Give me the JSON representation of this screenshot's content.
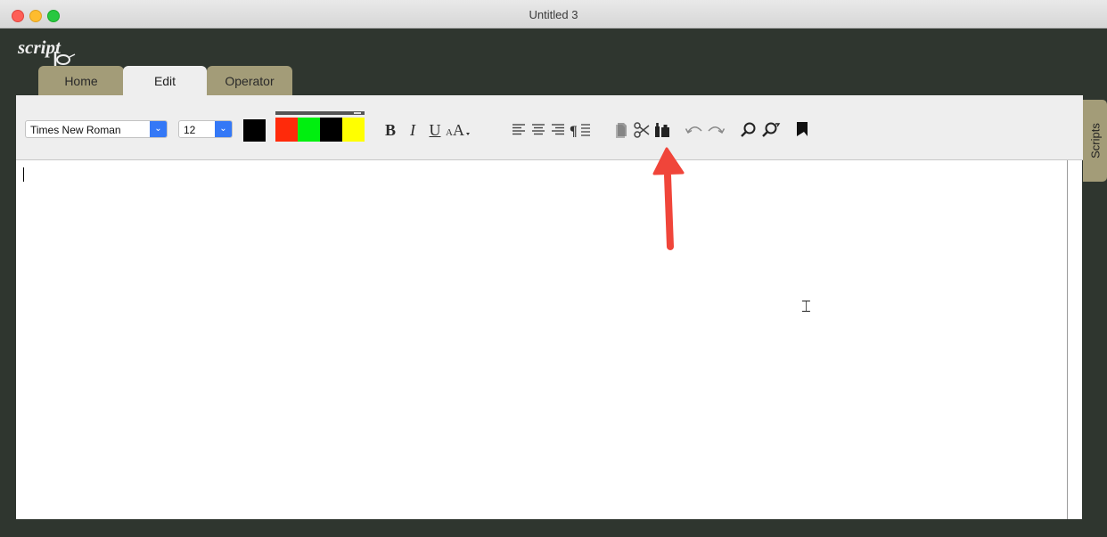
{
  "window": {
    "title": "Untitled 3"
  },
  "app": {
    "logo_text": "script"
  },
  "tabs": [
    {
      "label": "Home"
    },
    {
      "label": "Edit",
      "active": true
    },
    {
      "label": "Operator"
    }
  ],
  "toolbar": {
    "font": {
      "value": "Times New Roman"
    },
    "size": {
      "value": "12"
    },
    "text_color": "#000000",
    "highlight_colors": [
      "#ff2a0a",
      "#00ef0f",
      "#000000",
      "#ffff00"
    ],
    "format_labels": {
      "bold": "B",
      "italic": "I",
      "underline": "U",
      "text_size": "AA"
    },
    "icons": {
      "bold": "bold-icon",
      "italic": "italic-icon",
      "underline": "underline-icon",
      "text-size": "text-size-icon",
      "align-left": "align-left-icon",
      "align-center": "align-center-icon",
      "align-right": "align-right-icon",
      "paragraph": "paragraph-spacing-icon",
      "copy": "copy-icon",
      "cut": "scissors-icon",
      "paste": "paste-icon",
      "undo": "undo-icon",
      "redo": "redo-icon",
      "find": "find-icon",
      "find-replace": "find-replace-icon",
      "bookmark": "bookmark-icon"
    }
  },
  "side_panel": {
    "label": "Scripts"
  },
  "colors": {
    "chrome": "#2f362f",
    "tab_inactive": "#a39c78",
    "toolbar": "#eeeeee",
    "callout": "#f0453a"
  }
}
